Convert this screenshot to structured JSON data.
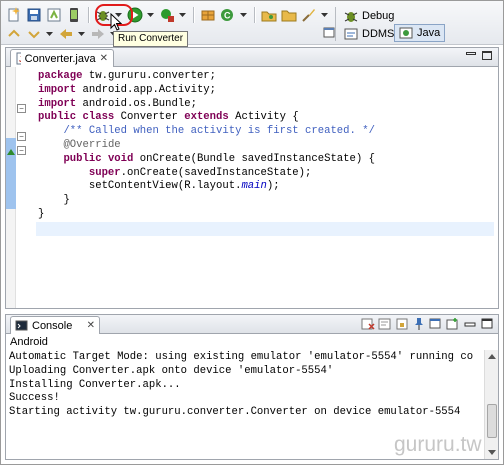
{
  "tooltip": {
    "text": "Run Converter"
  },
  "perspectives": {
    "debug_label": "Debug",
    "ddms_label": "DDMS",
    "java_label": "Java",
    "active": "Java"
  },
  "editor": {
    "tab_label": "Converter.java",
    "lines": [
      "package tw.gururu.converter;",
      "import android.app.Activity;",
      "import android.os.Bundle;",
      "public class Converter extends Activity {",
      "    /** Called when the activity is first created. */",
      "    @Override",
      "    public void onCreate(Bundle savedInstanceState) {",
      "        super.onCreate(savedInstanceState);",
      "        setContentView(R.layout.main);",
      "    }",
      "}",
      ""
    ]
  },
  "console": {
    "tab_label": "Console",
    "name": "Android",
    "lines": [
      "Automatic Target Mode: using existing emulator 'emulator-5554' running co",
      "Uploading Converter.apk onto device 'emulator-5554'",
      "Installing Converter.apk...",
      "Success!",
      "Starting activity tw.gururu.converter.Converter on device emulator-5554"
    ]
  },
  "watermark": "gururu.tw",
  "colors": {
    "keyword": "#7f0055",
    "comment": "#3f5fbf",
    "annotation": "#646464",
    "field": "#0000c0",
    "highlight_ring": "#e11b1b",
    "run_icon": "#2e9b2e"
  }
}
